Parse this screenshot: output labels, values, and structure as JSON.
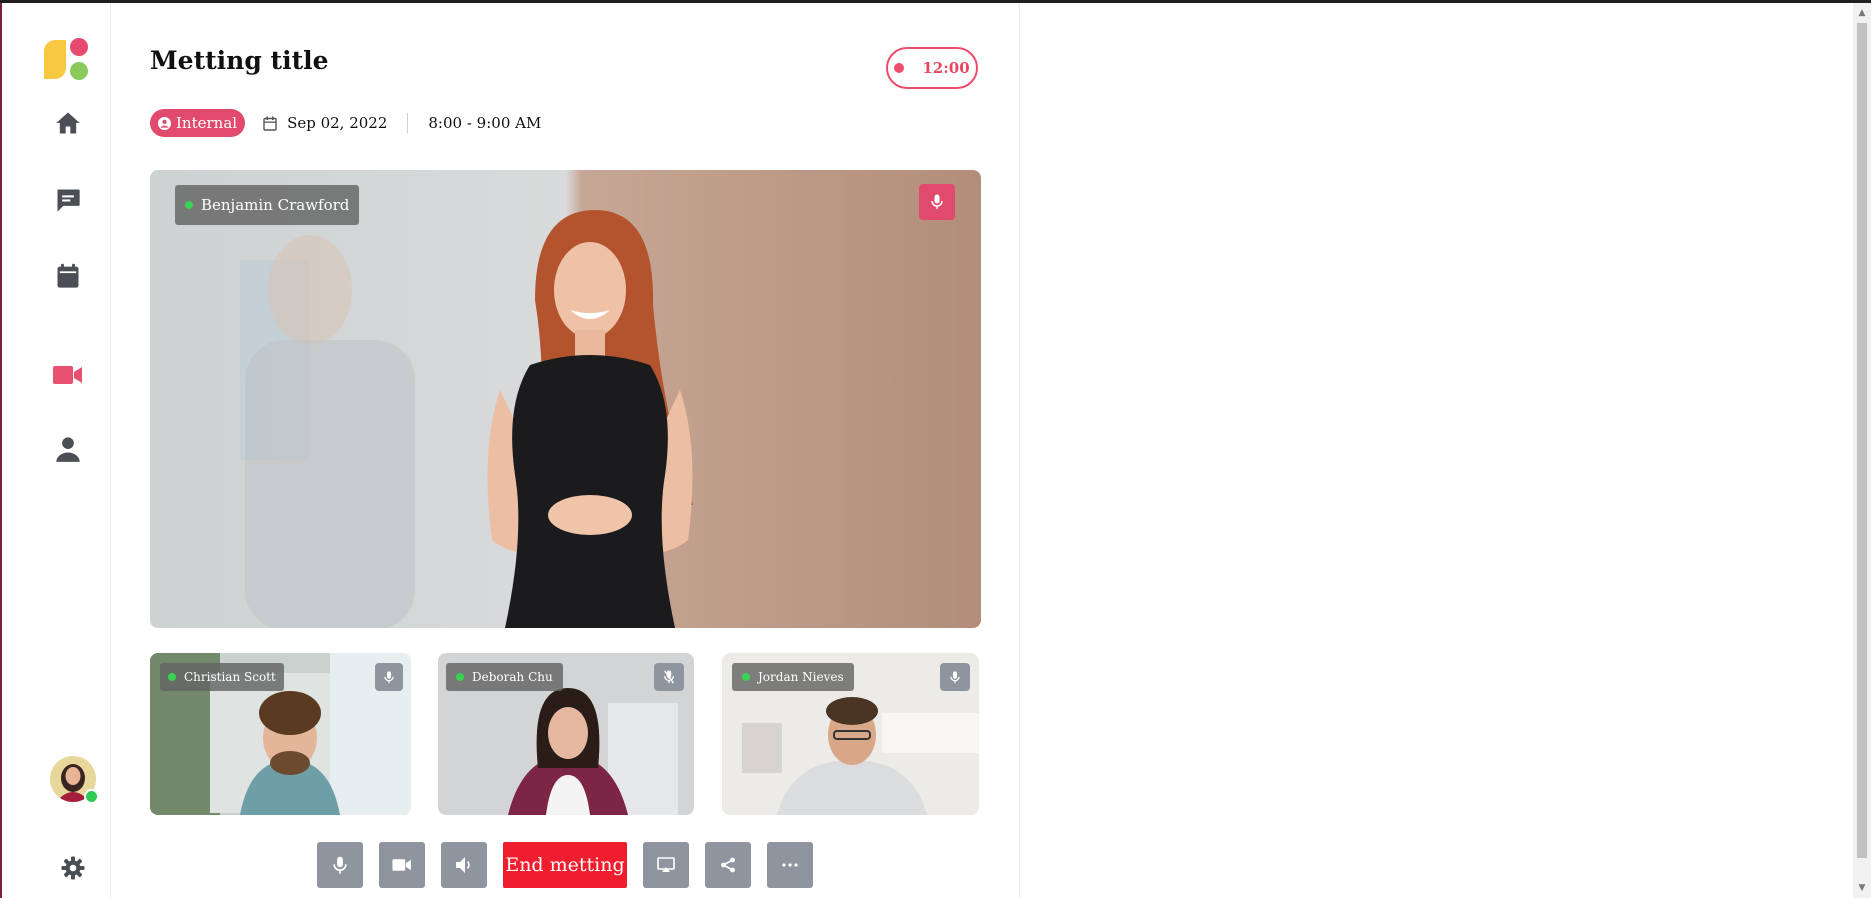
{
  "meeting": {
    "title": "Metting title",
    "timer": "12:00",
    "badge_label": "Internal",
    "date": "Sep 02, 2022",
    "time_range": "8:00 - 9:00 AM"
  },
  "main_speaker": {
    "name": "Benjamin Crawford",
    "mic": "on"
  },
  "participants": [
    {
      "name": "Christian Scott",
      "mic": "on"
    },
    {
      "name": "Deborah Chu",
      "mic": "muted"
    },
    {
      "name": "Jordan Nieves",
      "mic": "on"
    }
  ],
  "sidebar": {
    "items": [
      {
        "icon": "home-icon"
      },
      {
        "icon": "chat-icon"
      },
      {
        "icon": "calendar-icon"
      },
      {
        "icon": "video-icon",
        "active": true
      },
      {
        "icon": "user-icon"
      }
    ],
    "settings_icon": "gear-icon"
  },
  "controls": {
    "end_label": "End metting",
    "buttons": [
      "microphone-icon",
      "camera-icon",
      "speaker-icon",
      "screen-share-icon",
      "share-icon",
      "more-icon"
    ]
  },
  "colors": {
    "accent": "#e14a6d",
    "active_nav": "#e8506f",
    "end_button": "#ef1d2d",
    "control_button": "#8e959e",
    "online": "#39d353"
  }
}
